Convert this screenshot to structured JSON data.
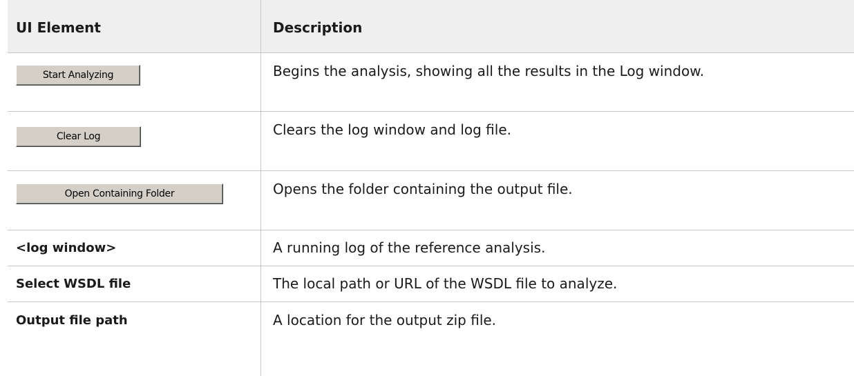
{
  "table": {
    "headers": {
      "ui_element": "UI Element",
      "description": "Description"
    },
    "rows": [
      {
        "type": "button",
        "element": "Start Analyzing",
        "description": "Begins the analysis, showing all the results in the Log window."
      },
      {
        "type": "button",
        "element": "Clear Log",
        "description": "Clears the log window and log file."
      },
      {
        "type": "button",
        "element": "Open Containing Folder",
        "description": "Opens the folder containing the output file."
      },
      {
        "type": "text",
        "element": "<log window>",
        "description": "A running log of the reference analysis."
      },
      {
        "type": "text",
        "element": "Select WSDL file",
        "description": "The local path or URL of the WSDL file to analyze."
      },
      {
        "type": "text",
        "element": "Output file path",
        "description": "A location for the output zip file."
      }
    ]
  },
  "colors": {
    "header_background": "#efefef",
    "grid_line": "#c6c6c6",
    "button_face": "#d4d0c8",
    "text": "#1a1a1a"
  }
}
